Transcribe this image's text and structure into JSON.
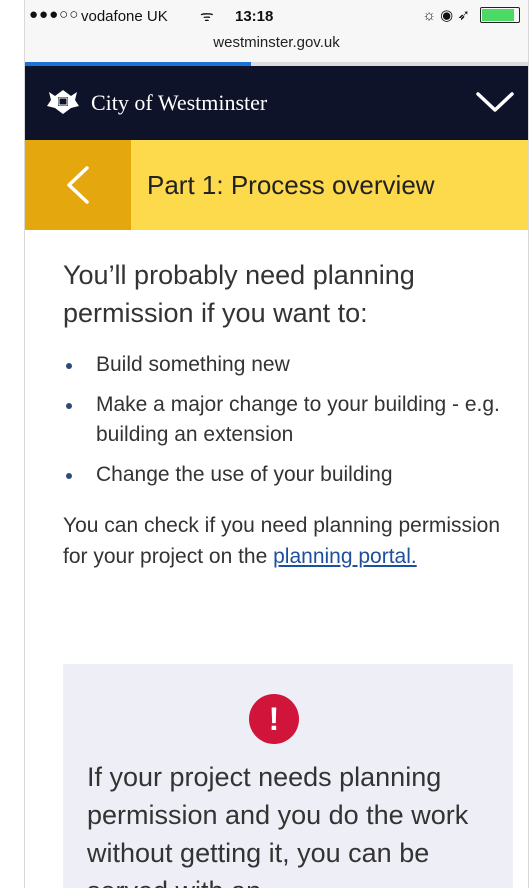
{
  "status_bar": {
    "signal": "●●●○○",
    "carrier": "vodafone UK",
    "wifi": "ᯤ",
    "time": "13:18",
    "icons": "☼ ◉ ➶",
    "battery_icon": "battery-charging",
    "url": "westminster.gov.uk",
    "load_progress_percent": 45
  },
  "header": {
    "crest_icon": "westminster-crest",
    "brand": "City of Westminster",
    "menu_icon": "chevron-down"
  },
  "section": {
    "back_icon": "chevron-left",
    "title": "Part 1: Process overview"
  },
  "content": {
    "intro": "You’ll probably need planning permission if you want to:",
    "bullets": [
      "Build something new",
      "Make a major change to your building - e.g. building an extension",
      "Change the use of your building"
    ],
    "check_text": "You can check if you need planning permission for your project on the",
    "link_text": "planning portal.",
    "warning_icon": "exclamation",
    "warning_text": "If your project needs planning permission and you do the work without getting it, you can be served with an"
  },
  "colors": {
    "nav_bg": "#0f1329",
    "section_bg": "#fdd94c",
    "back_bg": "#e4a80e",
    "warning_bg": "#eeeef7",
    "alert": "#d0143a",
    "link": "#1d4f9c"
  }
}
